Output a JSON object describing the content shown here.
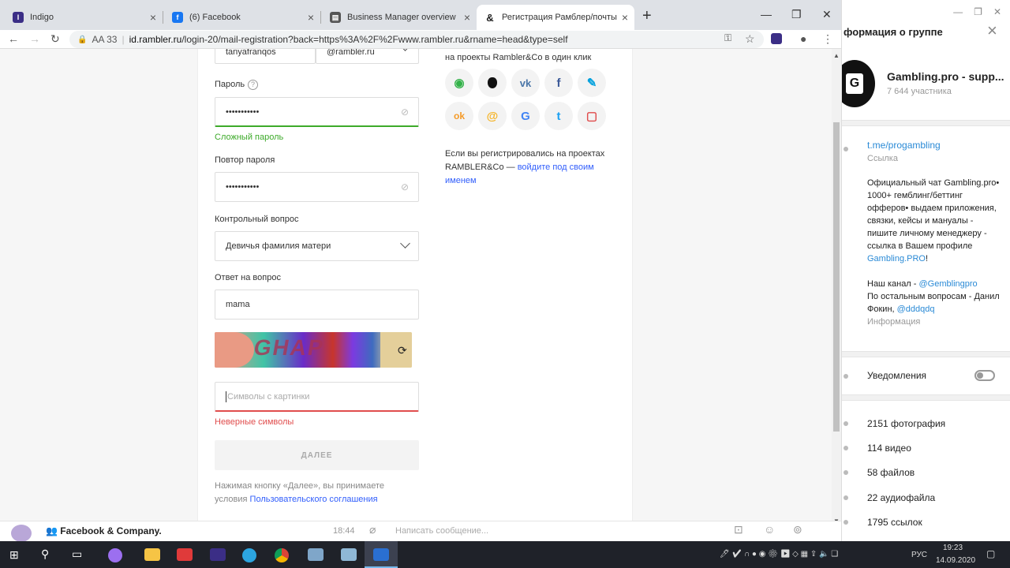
{
  "browser": {
    "tabs": [
      {
        "title": "Indigo",
        "icon": "indigo-icon",
        "color": "#3b2e86"
      },
      {
        "title": "(6) Facebook",
        "icon": "facebook-icon",
        "color": "#1877f2"
      },
      {
        "title": "Business Manager overview",
        "icon": "business-manager-icon",
        "color": "#555"
      },
      {
        "title": "Регистрация Рамблер/почты",
        "icon": "rambler-icon",
        "color": "#222"
      }
    ],
    "new_tab": "+",
    "address": {
      "label": "AA 33",
      "url_host": "id.rambler.ru",
      "url_path": "/login-20/mail-registration?back=https%3A%2F%2Fwww.rambler.ru&rname=head&type=self"
    }
  },
  "form": {
    "login_value": "tanyafranqos",
    "domain_value": "@rambler.ru",
    "password_label": "Пароль",
    "password_value": "•••••••••••",
    "password_strength": "Сложный пароль",
    "repeat_label": "Повтор пароля",
    "repeat_value": "•••••••••••",
    "question_label": "Контрольный вопрос",
    "question_value": "Девичья фамилия матери",
    "answer_label": "Ответ на вопрос",
    "answer_value": "mama",
    "captcha_text": "GHAP",
    "captcha_placeholder": "Символы с картинки",
    "captcha_error": "Неверные символы",
    "next_button": "ДАЛЕЕ",
    "terms_text": "Нажимая кнопку «Далее», вы принимаете условия",
    "terms_link": "Пользовательского соглашения"
  },
  "social": {
    "header": "на проекты Rambler&Co в один клик",
    "icons": [
      {
        "name": "rambler-social-icon",
        "glyph": "◉",
        "color": "#33b249"
      },
      {
        "name": "apple-icon",
        "glyph": "",
        "color": "#111"
      },
      {
        "name": "vk-icon",
        "glyph": "vk",
        "color": "#4a76a8"
      },
      {
        "name": "facebook-social-icon",
        "glyph": "f",
        "color": "#3b5998"
      },
      {
        "name": "livejournal-icon",
        "glyph": "✎",
        "color": "#00a0dd"
      },
      {
        "name": "odnoklassniki-icon",
        "glyph": "ok",
        "color": "#f59a27"
      },
      {
        "name": "mailru-icon",
        "glyph": "@",
        "color": "#f5b324"
      },
      {
        "name": "google-icon",
        "glyph": "G",
        "color": "#4285f4"
      },
      {
        "name": "twitter-icon",
        "glyph": "t",
        "color": "#1da1f2"
      },
      {
        "name": "gosuslugi-icon",
        "glyph": "▢",
        "color": "#e04d4d"
      }
    ],
    "note": "Если вы регистрировались на проектах RAMBLER&Co —",
    "note_link": "войдите под своим именем"
  },
  "telegram": {
    "panel_title": "формация о группе",
    "group_name": "Gambling.pro - supp...",
    "members": "7 644 участника",
    "link": "t.me/progambling",
    "link_label": "Ссылка",
    "desc_1": "Официальный чат Gambling.pro• 1000+ гемблинг/беттинг офферов• выдаем приложения, связки, кейсы и мануалы - пишите личному менеджеру - ссылка в Вашем профиле",
    "desc_link": "Gambling.PRO",
    "desc_2": "Наш канал -",
    "desc_channel": "@Gemblingpro",
    "desc_3": "По остальным вопросам - Данил Фокин,",
    "desc_contact": "@dddqdq",
    "info_label": "Информация",
    "notif_label": "Уведомления",
    "stats": [
      "2151 фотография",
      "114 видео",
      "58 файлов",
      "22 аудиофайла",
      "1795 ссылок"
    ],
    "chat_name": "Facebook & Company.",
    "chat_time": "18:44",
    "message_placeholder": "Написать сообщение..."
  },
  "taskbar": {
    "lang": "РУС",
    "time": "19:23",
    "date": "14.09.2020"
  }
}
